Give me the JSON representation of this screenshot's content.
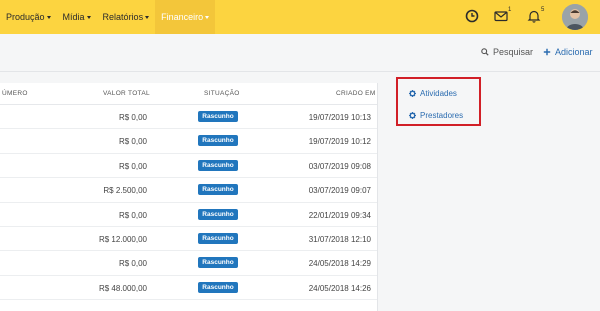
{
  "nav": {
    "items": [
      {
        "label": "Produção"
      },
      {
        "label": "Mídia"
      },
      {
        "label": "Relatórios"
      },
      {
        "label": "Financeiro"
      }
    ],
    "mail_count": "1",
    "notif_count": "5"
  },
  "toolbar": {
    "search_label": "Pesquisar",
    "add_label": "Adicionar"
  },
  "table": {
    "columns": {
      "numero": "ÚMERO",
      "valor": "VALOR TOTAL",
      "situacao": "SITUAÇÃO",
      "criado": "CRIADO EM"
    },
    "rows": [
      {
        "valor": "R$ 0,00",
        "status": "Rascunho",
        "criado": "19/07/2019 10:13"
      },
      {
        "valor": "R$ 0,00",
        "status": "Rascunho",
        "criado": "19/07/2019 10:12"
      },
      {
        "valor": "R$ 0,00",
        "status": "Rascunho",
        "criado": "03/07/2019 09:08"
      },
      {
        "valor": "R$ 2.500,00",
        "status": "Rascunho",
        "criado": "03/07/2019 09:07"
      },
      {
        "valor": "R$ 0,00",
        "status": "Rascunho",
        "criado": "22/01/2019 09:34"
      },
      {
        "valor": "R$ 12.000,00",
        "status": "Rascunho",
        "criado": "31/07/2018 12:10"
      },
      {
        "valor": "R$ 0,00",
        "status": "Rascunho",
        "criado": "24/05/2018 14:29"
      },
      {
        "valor": "R$ 48.000,00",
        "status": "Rascunho",
        "criado": "24/05/2018 14:26"
      }
    ]
  },
  "sidebar": {
    "links": [
      {
        "label": "Atividades",
        "icon": "gear-icon"
      },
      {
        "label": "Prestadores",
        "icon": "gear-icon"
      }
    ]
  },
  "colors": {
    "navbar": "#fcd440",
    "badge": "#2176bd",
    "link": "#2b6cb0",
    "highlight": "#d11f27"
  }
}
